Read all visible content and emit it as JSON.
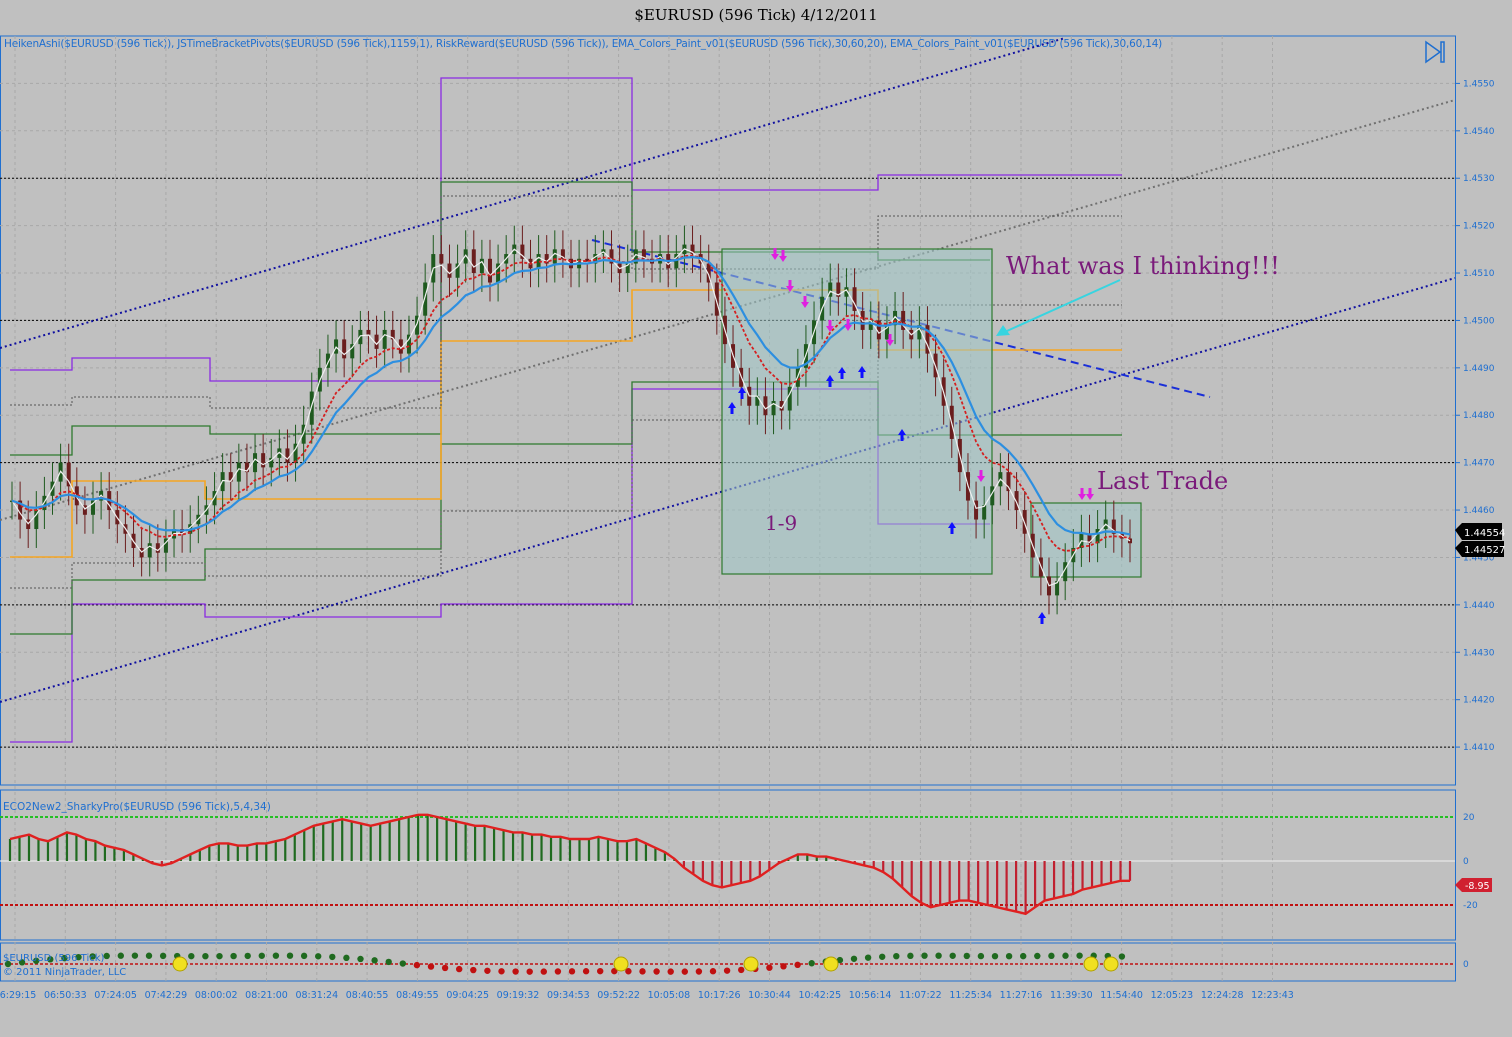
{
  "window": {
    "title": "$EURUSD (596 Tick)  4/12/2011",
    "indicators_label": "HeikenAshi($EURUSD (596 Tick)), JSTimeBracketPivots($EURUSD (596 Tick),1159,1), RiskReward($EURUSD (596 Tick)), EMA_Colors_Paint_v01($EURUSD (596 Tick),30,60,20), EMA_Colors_Paint_v01($EURUSD (596 Tick),30,60,14)",
    "osc1_label": "ECO2New2_SharkyPro($EURUSD (596 Tick),5,4,34)",
    "osc2_label": "$EURUSD (596 Tick)",
    "copyright": "© 2011 NinjaTrader, LLC",
    "colors": {
      "background": "#c0c0c0",
      "bull_bar": "#1f5a1f",
      "bear_bar": "#6a1e1e",
      "ema_fast": "#d42020",
      "ema_slow": "#2d8fe0",
      "pivot_upper": "#8a2be2",
      "pivot_mid": "#2e7a2e",
      "risk_line": "#f5a623",
      "trend_line": "#1010a0",
      "accent": "#1f6fd0"
    }
  },
  "annotations": {
    "thinking": "What was I thinking!!!",
    "last_trade": "Last Trade",
    "range": "1-9"
  },
  "price_badges": [
    "1.44554",
    "1.44527"
  ],
  "osc_badge": "-8.95",
  "chart_data": [
    {
      "type": "candlestick",
      "ylim": [
        1.4402,
        1.456
      ],
      "y_ticks": [
        "1.4550",
        "1.4540",
        "1.4530",
        "1.4520",
        "1.4510",
        "1.4500",
        "1.4490",
        "1.4480",
        "1.4470",
        "1.4460",
        "1.4450",
        "1.4440",
        "1.4430",
        "1.4420",
        "1.4410"
      ],
      "x_ticks": [
        "06:29:15",
        "06:50:33",
        "07:24:05",
        "07:42:29",
        "08:00:02",
        "08:21:00",
        "08:31:24",
        "08:40:55",
        "08:49:55",
        "09:04:25",
        "09:19:32",
        "09:34:53",
        "09:52:22",
        "10:05:08",
        "10:17:26",
        "10:30:44",
        "10:42:25",
        "10:56:14",
        "11:07:22",
        "11:25:34",
        "11:27:16",
        "11:39:30",
        "11:54:40",
        "12:05:23",
        "12:24:28",
        "12:23:43"
      ],
      "close": [
        1.4462,
        1.4458,
        1.4456,
        1.446,
        1.4463,
        1.4466,
        1.447,
        1.4465,
        1.4461,
        1.4459,
        1.4462,
        1.4464,
        1.446,
        1.4457,
        1.4455,
        1.4452,
        1.445,
        1.4453,
        1.4451,
        1.4454,
        1.4456,
        1.4455,
        1.4457,
        1.4459,
        1.4461,
        1.4464,
        1.4468,
        1.4466,
        1.447,
        1.4468,
        1.4472,
        1.4469,
        1.4471,
        1.4473,
        1.447,
        1.4474,
        1.4478,
        1.4485,
        1.449,
        1.4493,
        1.4496,
        1.4492,
        1.4495,
        1.4498,
        1.4497,
        1.4494,
        1.4498,
        1.4496,
        1.4493,
        1.4497,
        1.4501,
        1.4508,
        1.4514,
        1.4512,
        1.4509,
        1.4512,
        1.4515,
        1.451,
        1.4513,
        1.4508,
        1.4512,
        1.4514,
        1.4516,
        1.4513,
        1.4511,
        1.4514,
        1.4512,
        1.4515,
        1.4513,
        1.4511,
        1.4513,
        1.4512,
        1.4514,
        1.4515,
        1.4512,
        1.451,
        1.4512,
        1.4515,
        1.4513,
        1.4512,
        1.4514,
        1.4511,
        1.4514,
        1.4516,
        1.4514,
        1.4512,
        1.4508,
        1.4501,
        1.4495,
        1.449,
        1.4486,
        1.4482,
        1.4484,
        1.448,
        1.4483,
        1.4481,
        1.4486,
        1.449,
        1.4495,
        1.45,
        1.4505,
        1.4508,
        1.4505,
        1.4507,
        1.4502,
        1.4498,
        1.45,
        1.4496,
        1.4499,
        1.4502,
        1.4498,
        1.4496,
        1.4499,
        1.4493,
        1.4488,
        1.4482,
        1.4475,
        1.4468,
        1.4462,
        1.4458,
        1.4461,
        1.4465,
        1.4468,
        1.4464,
        1.446,
        1.4455,
        1.445,
        1.4446,
        1.4442,
        1.4445,
        1.4449,
        1.4452,
        1.4455,
        1.4453,
        1.4456,
        1.4458,
        1.4455,
        1.4454,
        1.4453
      ]
    },
    {
      "type": "bar",
      "name_label": "ECO2New2_SharkyPro",
      "ylim": [
        -25,
        25
      ],
      "y_ticks": [
        "20",
        "0",
        "-20"
      ],
      "last_value": -8.95,
      "values": [
        10,
        11,
        12,
        10,
        9,
        11,
        13,
        12,
        10,
        9,
        7,
        6,
        5,
        3,
        1,
        -1,
        -2,
        -1,
        1,
        3,
        5,
        7,
        8,
        8,
        7,
        7,
        8,
        8,
        9,
        10,
        12,
        14,
        16,
        17,
        18,
        19,
        18,
        17,
        16,
        17,
        18,
        19,
        20,
        21,
        21,
        20,
        19,
        18,
        17,
        16,
        16,
        15,
        14,
        13,
        13,
        12,
        12,
        11,
        11,
        10,
        10,
        10,
        11,
        10,
        9,
        9,
        10,
        8,
        6,
        4,
        1,
        -3,
        -6,
        -9,
        -11,
        -12,
        -11,
        -10,
        -9,
        -7,
        -4,
        -1,
        1,
        3,
        3,
        2,
        2,
        1,
        0,
        -1,
        -2,
        -3,
        -5,
        -8,
        -12,
        -16,
        -19,
        -21,
        -20,
        -19,
        -18,
        -18,
        -19,
        -20,
        -21,
        -22,
        -23,
        -24,
        -21,
        -18,
        -17,
        -16,
        -15,
        -13,
        -12,
        -11,
        -10,
        -9,
        -9
      ]
    }
  ]
}
